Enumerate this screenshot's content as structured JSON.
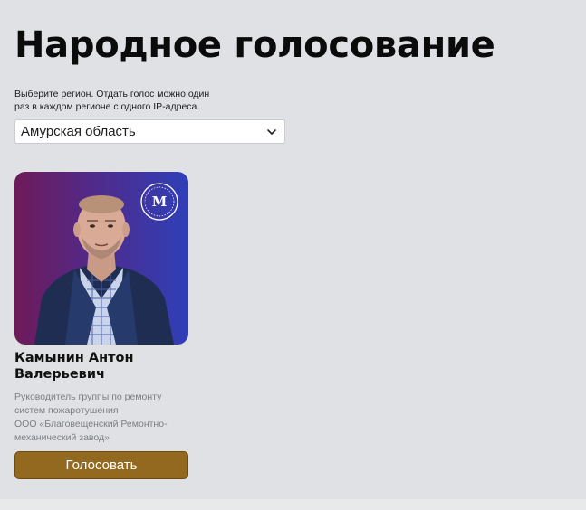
{
  "page": {
    "title": "Народное голосование",
    "hint": "Выберите регион. Отдать голос можно один\nраз в каждом регионе с одного IP-адреса."
  },
  "region_select": {
    "value": "Амурская область",
    "icon": "chevron-down-icon"
  },
  "candidates": [
    {
      "name": "Камынин Антон Валерьевич",
      "position": "Руководитель группы по ремонту систем пожаротушения",
      "company": "ООО «Благовещенский Ремонтно-механический завод»",
      "vote_label": "Голосовать",
      "logo_text": "М"
    }
  ],
  "colors": {
    "background": "#dfe1e4",
    "button": "#93681f",
    "photo_gradient_left": "#6e1a58",
    "photo_gradient_right": "#2f3fb8"
  }
}
